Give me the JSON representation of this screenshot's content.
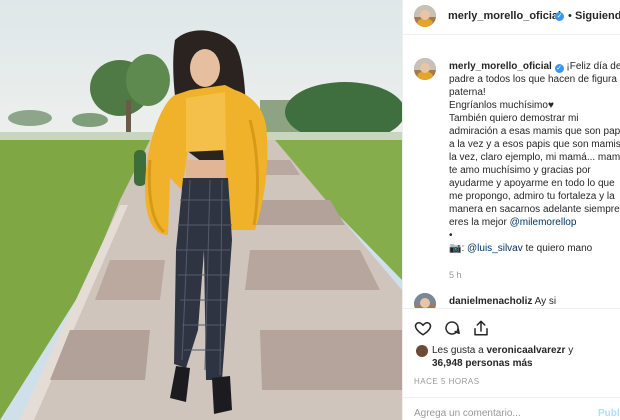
{
  "post": {
    "username": "merly_morello_oficial",
    "follow_label": "Siguiendo",
    "separator": "•"
  },
  "caption": {
    "author": "merly_morello_oficial",
    "lines": [
      "¡Feliz día de",
      "padre a todos los que hacen de figura",
      "paterna!",
      "Engríanlos muchísimo",
      "También quiero demostrar mi",
      "admiración a esas mamis que son papá",
      "a la vez y a esos papis que son mamis a",
      "la vez, claro ejemplo, mi mamá... mami",
      "te amo muchísimo y gracias por",
      "ayudarme y apoyarme en todo lo que",
      "me propongo, admiro tu fortaleza y la",
      "manera en sacarnos adelante siempre,",
      "eres la mejor"
    ],
    "heart": "♥",
    "mention_mom": "@milemorellop",
    "bullet": "•",
    "photo_credit_prefix": "📷:",
    "mention_photographer": "@luis_silvav",
    "credit_suffix": "te quiero mano",
    "time": "5 h"
  },
  "comment": {
    "author": "danielmenacholiz",
    "text": "Ay si"
  },
  "actions": {
    "icons": [
      "heart-icon",
      "comment-icon",
      "share-icon",
      "bookmark-icon"
    ]
  },
  "likes": {
    "prefix": "Les gusta a",
    "user": "veronicaalvarezr",
    "connector": "y",
    "count": "36,948 personas más"
  },
  "timestamp": "HACE 5 HORAS",
  "add_comment": {
    "placeholder": "Agrega un comentario...",
    "publish": "Publicar"
  }
}
